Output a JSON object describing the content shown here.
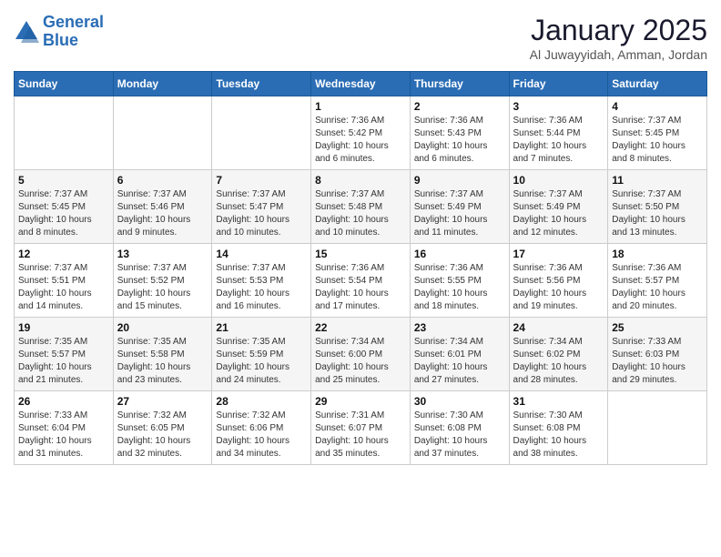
{
  "header": {
    "logo_line1": "General",
    "logo_line2": "Blue",
    "month": "January 2025",
    "location": "Al Juwayyidah, Amman, Jordan"
  },
  "weekdays": [
    "Sunday",
    "Monday",
    "Tuesday",
    "Wednesday",
    "Thursday",
    "Friday",
    "Saturday"
  ],
  "weeks": [
    [
      {
        "day": "",
        "info": ""
      },
      {
        "day": "",
        "info": ""
      },
      {
        "day": "",
        "info": ""
      },
      {
        "day": "1",
        "info": "Sunrise: 7:36 AM\nSunset: 5:42 PM\nDaylight: 10 hours\nand 6 minutes."
      },
      {
        "day": "2",
        "info": "Sunrise: 7:36 AM\nSunset: 5:43 PM\nDaylight: 10 hours\nand 6 minutes."
      },
      {
        "day": "3",
        "info": "Sunrise: 7:36 AM\nSunset: 5:44 PM\nDaylight: 10 hours\nand 7 minutes."
      },
      {
        "day": "4",
        "info": "Sunrise: 7:37 AM\nSunset: 5:45 PM\nDaylight: 10 hours\nand 8 minutes."
      }
    ],
    [
      {
        "day": "5",
        "info": "Sunrise: 7:37 AM\nSunset: 5:45 PM\nDaylight: 10 hours\nand 8 minutes."
      },
      {
        "day": "6",
        "info": "Sunrise: 7:37 AM\nSunset: 5:46 PM\nDaylight: 10 hours\nand 9 minutes."
      },
      {
        "day": "7",
        "info": "Sunrise: 7:37 AM\nSunset: 5:47 PM\nDaylight: 10 hours\nand 10 minutes."
      },
      {
        "day": "8",
        "info": "Sunrise: 7:37 AM\nSunset: 5:48 PM\nDaylight: 10 hours\nand 10 minutes."
      },
      {
        "day": "9",
        "info": "Sunrise: 7:37 AM\nSunset: 5:49 PM\nDaylight: 10 hours\nand 11 minutes."
      },
      {
        "day": "10",
        "info": "Sunrise: 7:37 AM\nSunset: 5:49 PM\nDaylight: 10 hours\nand 12 minutes."
      },
      {
        "day": "11",
        "info": "Sunrise: 7:37 AM\nSunset: 5:50 PM\nDaylight: 10 hours\nand 13 minutes."
      }
    ],
    [
      {
        "day": "12",
        "info": "Sunrise: 7:37 AM\nSunset: 5:51 PM\nDaylight: 10 hours\nand 14 minutes."
      },
      {
        "day": "13",
        "info": "Sunrise: 7:37 AM\nSunset: 5:52 PM\nDaylight: 10 hours\nand 15 minutes."
      },
      {
        "day": "14",
        "info": "Sunrise: 7:37 AM\nSunset: 5:53 PM\nDaylight: 10 hours\nand 16 minutes."
      },
      {
        "day": "15",
        "info": "Sunrise: 7:36 AM\nSunset: 5:54 PM\nDaylight: 10 hours\nand 17 minutes."
      },
      {
        "day": "16",
        "info": "Sunrise: 7:36 AM\nSunset: 5:55 PM\nDaylight: 10 hours\nand 18 minutes."
      },
      {
        "day": "17",
        "info": "Sunrise: 7:36 AM\nSunset: 5:56 PM\nDaylight: 10 hours\nand 19 minutes."
      },
      {
        "day": "18",
        "info": "Sunrise: 7:36 AM\nSunset: 5:57 PM\nDaylight: 10 hours\nand 20 minutes."
      }
    ],
    [
      {
        "day": "19",
        "info": "Sunrise: 7:35 AM\nSunset: 5:57 PM\nDaylight: 10 hours\nand 21 minutes."
      },
      {
        "day": "20",
        "info": "Sunrise: 7:35 AM\nSunset: 5:58 PM\nDaylight: 10 hours\nand 23 minutes."
      },
      {
        "day": "21",
        "info": "Sunrise: 7:35 AM\nSunset: 5:59 PM\nDaylight: 10 hours\nand 24 minutes."
      },
      {
        "day": "22",
        "info": "Sunrise: 7:34 AM\nSunset: 6:00 PM\nDaylight: 10 hours\nand 25 minutes."
      },
      {
        "day": "23",
        "info": "Sunrise: 7:34 AM\nSunset: 6:01 PM\nDaylight: 10 hours\nand 27 minutes."
      },
      {
        "day": "24",
        "info": "Sunrise: 7:34 AM\nSunset: 6:02 PM\nDaylight: 10 hours\nand 28 minutes."
      },
      {
        "day": "25",
        "info": "Sunrise: 7:33 AM\nSunset: 6:03 PM\nDaylight: 10 hours\nand 29 minutes."
      }
    ],
    [
      {
        "day": "26",
        "info": "Sunrise: 7:33 AM\nSunset: 6:04 PM\nDaylight: 10 hours\nand 31 minutes."
      },
      {
        "day": "27",
        "info": "Sunrise: 7:32 AM\nSunset: 6:05 PM\nDaylight: 10 hours\nand 32 minutes."
      },
      {
        "day": "28",
        "info": "Sunrise: 7:32 AM\nSunset: 6:06 PM\nDaylight: 10 hours\nand 34 minutes."
      },
      {
        "day": "29",
        "info": "Sunrise: 7:31 AM\nSunset: 6:07 PM\nDaylight: 10 hours\nand 35 minutes."
      },
      {
        "day": "30",
        "info": "Sunrise: 7:30 AM\nSunset: 6:08 PM\nDaylight: 10 hours\nand 37 minutes."
      },
      {
        "day": "31",
        "info": "Sunrise: 7:30 AM\nSunset: 6:08 PM\nDaylight: 10 hours\nand 38 minutes."
      },
      {
        "day": "",
        "info": ""
      }
    ]
  ]
}
